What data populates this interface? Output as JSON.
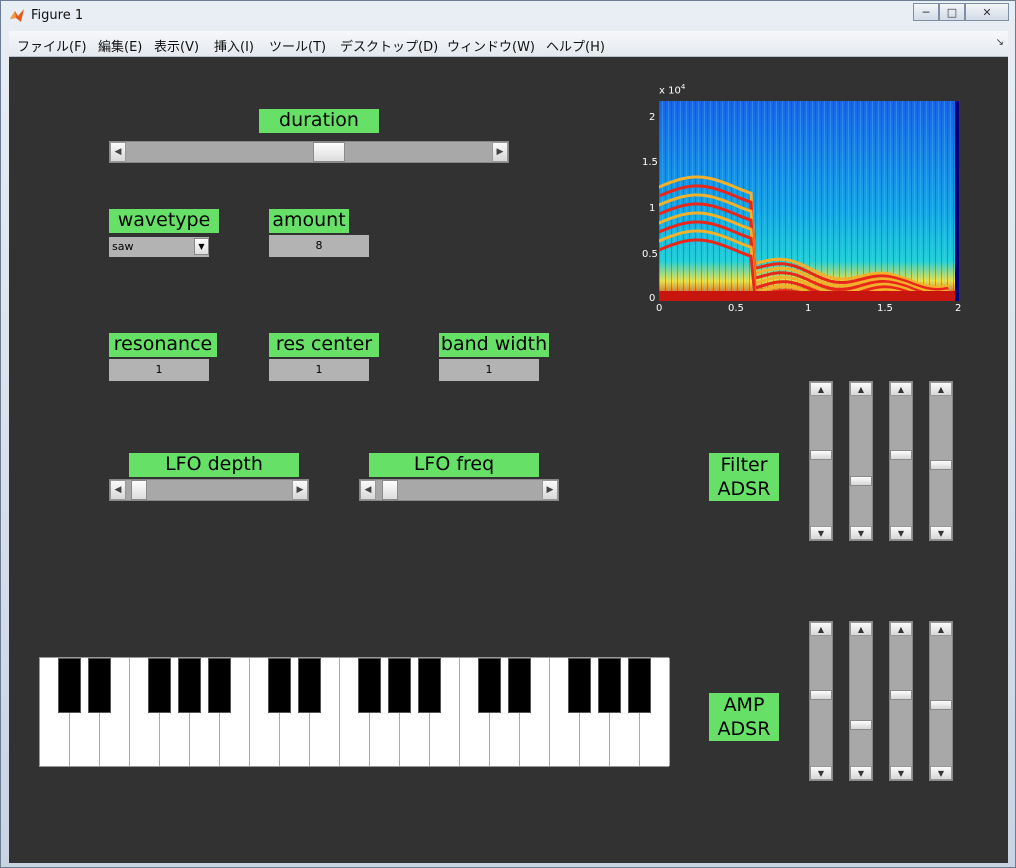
{
  "window": {
    "title": "Figure 1",
    "minimize_icon": "minimize-icon",
    "maximize_icon": "maximize-icon",
    "close_icon": "close-icon"
  },
  "menu": [
    "ファイル(F)",
    "編集(E)",
    "表示(V)",
    "挿入(I)",
    "ツール(T)",
    "デスクトップ(D)",
    "ウィンドウ(W)",
    "ヘルプ(H)"
  ],
  "controls": {
    "duration": {
      "label": "duration",
      "value_fraction": 0.56
    },
    "wavetype": {
      "label": "wavetype",
      "selected": "saw"
    },
    "amount": {
      "label": "amount",
      "value": "8"
    },
    "resonance": {
      "label": "resonance",
      "value": "1"
    },
    "res_center": {
      "label": "res center",
      "value": "1"
    },
    "band_width": {
      "label": "band width",
      "value": "1"
    },
    "lfo_depth": {
      "label": "LFO depth",
      "value_fraction": 0.03
    },
    "lfo_freq": {
      "label": "LFO freq",
      "value_fraction": 0.04
    }
  },
  "filter_adsr": {
    "label_line1": "Filter",
    "label_line2": "ADSR",
    "levels": [
      0.55,
      0.33,
      0.55,
      0.47
    ]
  },
  "amp_adsr": {
    "label_line1": "AMP",
    "label_line2": "ADSR",
    "levels": [
      0.55,
      0.3,
      0.55,
      0.47
    ]
  },
  "keyboard": {
    "white_keys": 21,
    "black_keys": 15
  },
  "spectrogram": {
    "exponent_label": "x 10",
    "exponent_power": "4",
    "y_ticks": [
      "2",
      "1.5",
      "1",
      "0.5",
      "0"
    ],
    "x_ticks": [
      "0",
      "0.5",
      "1",
      "1.5",
      "2"
    ],
    "colormap": "jet"
  },
  "colors": {
    "background": "#323232",
    "label_green": "#66e066"
  }
}
